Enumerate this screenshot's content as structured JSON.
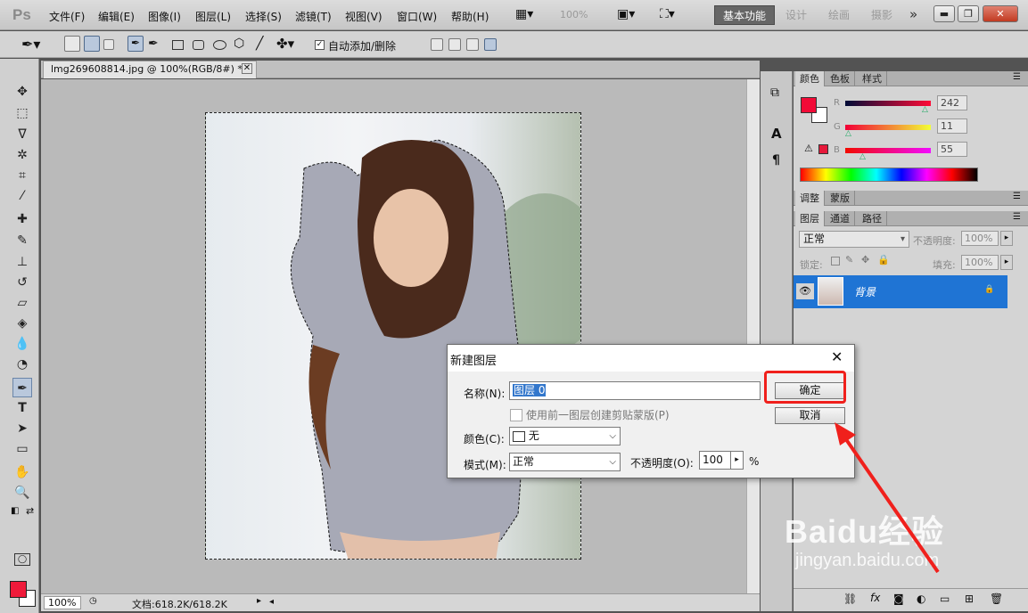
{
  "app": {
    "logo": "Ps",
    "menus": [
      "文件(F)",
      "编辑(E)",
      "图像(I)",
      "图层(L)",
      "选择(S)",
      "滤镜(T)",
      "视图(V)",
      "窗口(W)",
      "帮助(H)"
    ],
    "zoom_menu": "100%",
    "workspaces": [
      "基本功能",
      "设计",
      "绘画",
      "摄影"
    ],
    "more": "»"
  },
  "options": {
    "auto_add_delete": "自动添加/删除"
  },
  "document": {
    "tab_title": "lmg269608814.jpg @ 100%(RGB/8#) *",
    "zoom": "100%",
    "doc_size": "文档:618.2K/618.2K"
  },
  "color_panel": {
    "tabs": [
      "颜色",
      "色板",
      "样式"
    ],
    "channels": [
      {
        "label": "R",
        "value": "242"
      },
      {
        "label": "G",
        "value": "11"
      },
      {
        "label": "B",
        "value": "55"
      }
    ],
    "fg_color": "#f20b37"
  },
  "adjust_panel": {
    "tabs": [
      "调整",
      "蒙版"
    ]
  },
  "layers_panel": {
    "tabs": [
      "图层",
      "通道",
      "路径"
    ],
    "blend_mode": "正常",
    "opacity_label": "不透明度:",
    "opacity": "100%",
    "lock_label": "锁定:",
    "fill_label": "填充:",
    "fill": "100%",
    "layer_name": "背景"
  },
  "dialog": {
    "title": "新建图层",
    "name_label": "名称(N):",
    "name_value": "图层 0",
    "clip_label": "使用前一图层创建剪贴蒙版(P)",
    "color_label": "颜色(C):",
    "color_value": "无",
    "mode_label": "模式(M):",
    "mode_value": "正常",
    "opacity_label": "不透明度(O):",
    "opacity_value": "100",
    "percent": "%",
    "ok_label": "确定",
    "cancel_label": "取消"
  },
  "watermark": {
    "text": "Baidu经验",
    "url": "jingyan.baidu.com"
  },
  "highlight_color": "#f0201c"
}
